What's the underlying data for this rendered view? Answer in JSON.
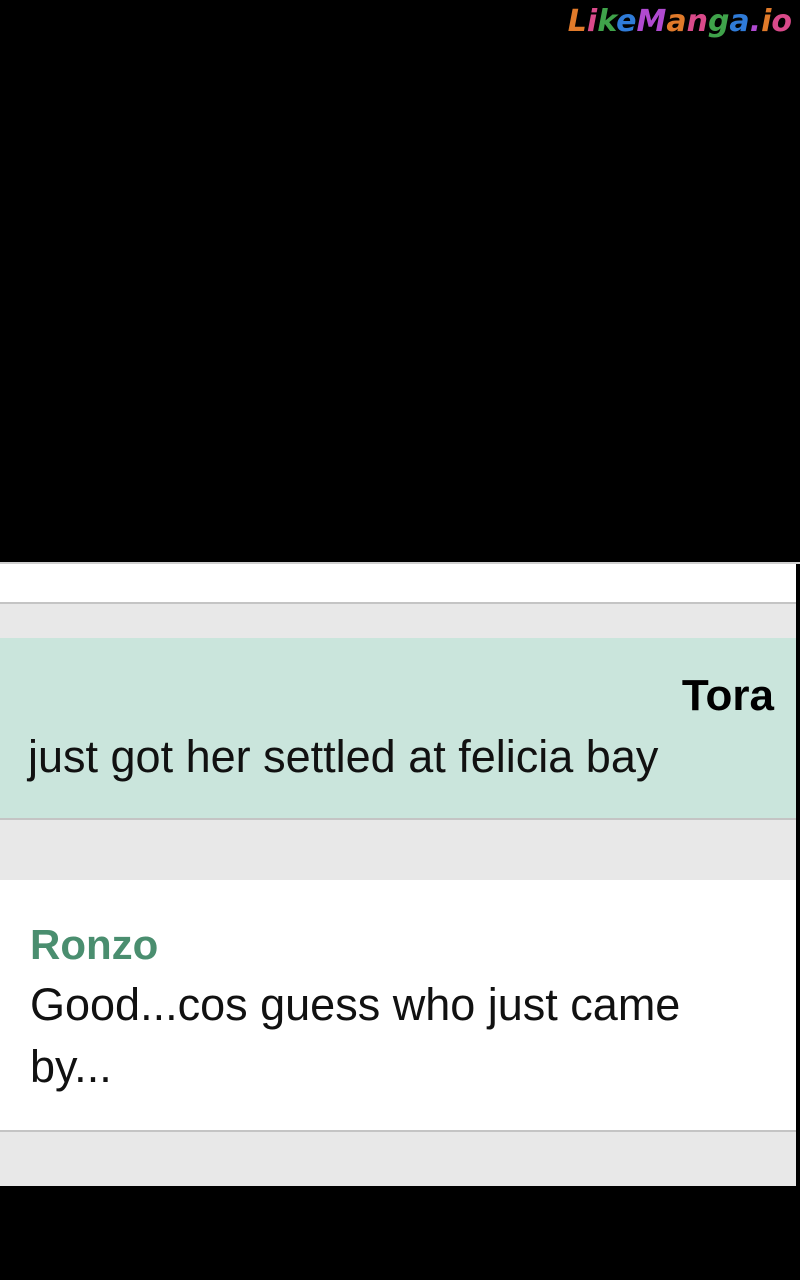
{
  "watermark": {
    "text": "LikeManga.io"
  },
  "messages": [
    {
      "sender": "Tora",
      "text": "just got her settled at felicia bay"
    },
    {
      "sender": "Ronzo",
      "text": "Good...cos guess who just came by..."
    }
  ],
  "colors": {
    "tora_bubble": "#cae5dc",
    "ronzo_name": "#4a8e6f",
    "gap": "#e8e8e8"
  }
}
